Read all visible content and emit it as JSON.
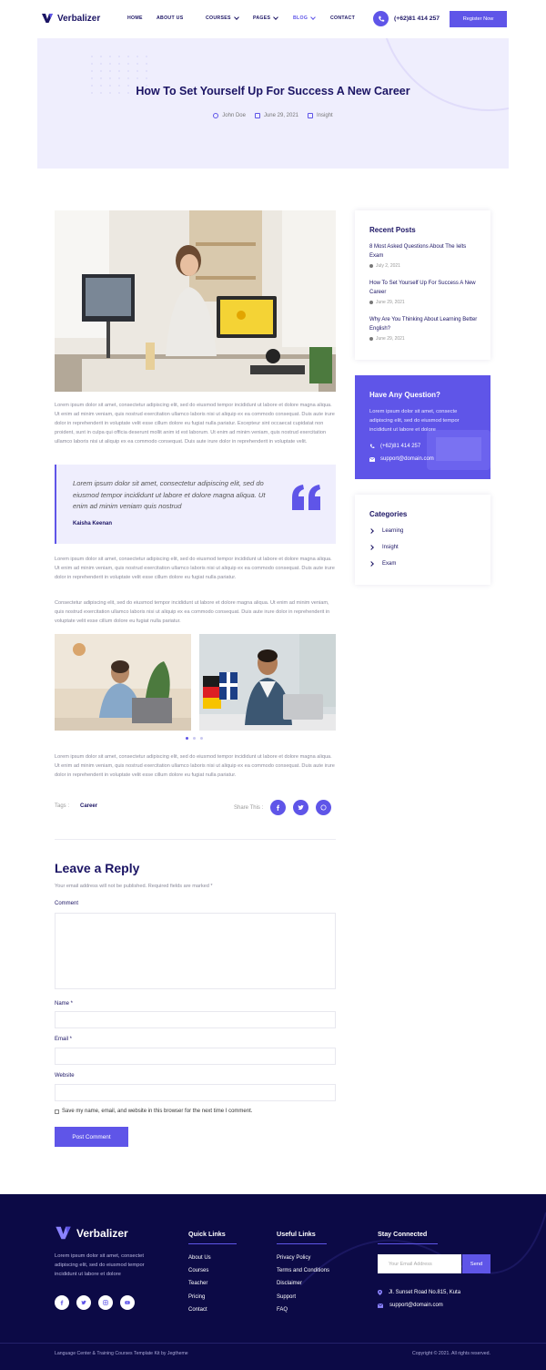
{
  "header": {
    "brand": "Verbalizer",
    "nav": [
      {
        "label": "HOME"
      },
      {
        "label": "ABOUT US"
      },
      {
        "label": "COURSES"
      },
      {
        "label": "PAGES"
      },
      {
        "label": "BLOG"
      },
      {
        "label": "CONTACT"
      }
    ],
    "phone": "(+62)81 414 257",
    "register_label": "Register Now"
  },
  "hero": {
    "title": "How To Set Yourself Up For Success A New Career",
    "author": "John Doe",
    "date": "June 29, 2021",
    "category": "Insight"
  },
  "article": {
    "para1": "Lorem ipsum dolor sit amet, consectetur adipiscing elit, sed do eiusmod tempor incididunt ut labore et dolore magna aliqua. Ut enim ad minim veniam, quis nostrud exercitation ullamco laboris nisi ut aliquip ex ea commodo consequat. Duis aute irure dolor in reprehenderit in voluptate velit esse cillum dolore eu fugiat nulla pariatur. Excepteur sint occaecat cupidatat non proident, sunt in culpa qui officia deserunt mollit anim id est laborum. Ut enim ad minim veniam, quis nostrud exercitation ullamco laboris nisi ut aliquip ex ea commodo consequat. Duis aute irure dolor in reprehenderit in voluptate velit.",
    "quote_text": "Lorem ipsum dolor sit amet, consectetur adipiscing elit, sed do eiusmod tempor incididunt ut labore et dolore magna aliqua. Ut enim ad minim veniam quis nostrud",
    "quote_author": "Kaisha Keenan",
    "para2": "Lorem ipsum dolor sit amet, consectetur adipiscing elit, sed do eiusmod tempor incididunt ut labore et dolore magna aliqua. Ut enim ad minim veniam, quis nostrud exercitation ullamco laboris nisi ut aliquip ex ea commodo consequat. Duis aute irure dolor in reprehenderit in voluptate velit esse cillum dolore eu fugiat nulla pariatur.",
    "para3": "Consectetur adipiscing elit, sed do eiusmod tempor incididunt ut labore et dolore magna aliqua. Ut enim ad minim veniam, quis nostrud exercitation ullamco laboris nisi ut aliquip ex ea commodo consequat. Duis aute irure dolor in reprehenderit in voluptate velit esse cillum dolore eu fugiat nulla pariatur.",
    "para4": "Lorem ipsum dolor sit amet, consectetur adipiscing elit, sed do eiusmod tempor incididunt ut labore et dolore magna aliqua. Ut enim ad minim veniam, quis nostrud exercitation ullamco laboris nisi ut aliquip ex ea commodo consequat. Duis aute irure dolor in reprehenderit in voluptate velit esse cillum dolore eu fugiat nulla pariatur.",
    "tags_label": "Tags :",
    "tag": "Career",
    "share_label": "Share This :"
  },
  "reply": {
    "title": "Leave a Reply",
    "note": "Your email address will not be published. Required fields are marked *",
    "comment_label": "Comment",
    "name_label": "Name *",
    "email_label": "Email *",
    "website_label": "Website",
    "save_label": "Save my name, email, and website in this browser for the next time I comment.",
    "submit_label": "Post Comment"
  },
  "sidebar": {
    "recent_title": "Recent Posts",
    "recent": [
      {
        "title": "8 Most Asked Questions About The Ielts Exam",
        "date": "July 2, 2021"
      },
      {
        "title": "How To Set Yourself Up For Success A New Career",
        "date": "June 29, 2021"
      },
      {
        "title": "Why Are You Thinking About Learning Better English?",
        "date": "June 29, 2021"
      }
    ],
    "question_title": "Have Any Question?",
    "question_text": "Lorem ipsum dolor sit amet, consecte adipiscing elit, sed do eiusmod tempor incididunt ut labore et dolore",
    "question_phone": "(+62)81 414 257",
    "question_email": "support@domain.com",
    "categories_title": "Categories",
    "categories": [
      "Learning",
      "Insight",
      "Exam"
    ]
  },
  "footer": {
    "brand": "Verbalizer",
    "desc": "Lorem ipsum dolor sit amet, consectet adipiscing elit, sed do eiusmod tempor incididunt ut labore et dolore",
    "quick_title": "Quick Links",
    "quick": [
      "About Us",
      "Courses",
      "Teacher",
      "Pricing",
      "Contact"
    ],
    "useful_title": "Useful Links",
    "useful": [
      "Privacy Policy",
      "Terms and Conditions",
      "Disclaimer",
      "Support",
      "FAQ"
    ],
    "stay_title": "Stay Connected",
    "email_placeholder": "Your Email Address",
    "send_label": "Send",
    "address": "Jl. Sunset Road No.815, Kuta",
    "email": "support@domain.com",
    "credit": "Language Center & Training Courses Template Kit by Jegtheme",
    "copyright": "Copyright © 2021. All rights reserved."
  },
  "colors": {
    "accent": "#5f55e8",
    "navy": "#1b1464",
    "footer": "#0c0a46",
    "hero_bg": "#efeefd"
  }
}
